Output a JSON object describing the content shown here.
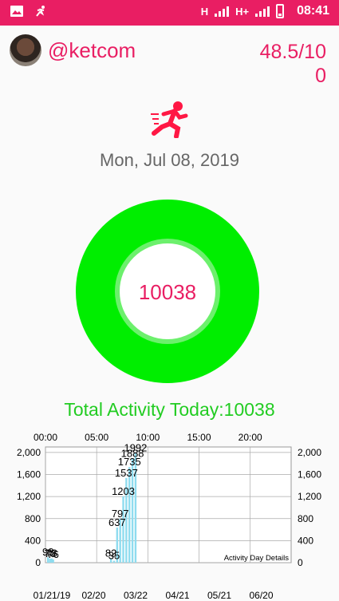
{
  "status_bar": {
    "network_1": "H",
    "network_2": "H+",
    "time": "08:41",
    "left_icons": [
      "image-icon",
      "run-notification-icon"
    ]
  },
  "header": {
    "username": "@ketcom",
    "score": "48.5/100"
  },
  "date": "Mon, Jul 08, 2019",
  "ring": {
    "value": "10038",
    "fill_color": "#00ee00",
    "fraction": 1.0
  },
  "total_label": "Total Activity Today:10038",
  "colors": {
    "accent": "#e91e63",
    "green": "#00ee00",
    "bar": "#8fdcef"
  },
  "chart_data": {
    "type": "bar",
    "top_axis_labels": [
      "00:00",
      "05:00",
      "10:00",
      "15:00",
      "20:00"
    ],
    "bottom_axis_labels": [
      "01/21/19",
      "02/20",
      "03/22",
      "04/21",
      "05/21",
      "06/20"
    ],
    "y_ticks": [
      "0",
      "400",
      "800",
      "1,200",
      "1,600",
      "2,000"
    ],
    "ylim": [
      0,
      2100
    ],
    "xlim_hours": [
      0,
      24
    ],
    "grid": true,
    "description_label": "Activity Day Details",
    "points": [
      {
        "hour": 0.25,
        "value": 98,
        "label": "98"
      },
      {
        "hour": 0.45,
        "value": 70,
        "label": "70"
      },
      {
        "hour": 0.6,
        "value": 78,
        "label": "78"
      },
      {
        "hour": 0.75,
        "value": 60,
        "label": "76"
      },
      {
        "hour": 6.4,
        "value": 82,
        "label": "82"
      },
      {
        "hour": 6.7,
        "value": 35,
        "label": "35"
      },
      {
        "hour": 7.0,
        "value": 637,
        "label": "637"
      },
      {
        "hour": 7.3,
        "value": 797,
        "label": "797"
      },
      {
        "hour": 7.6,
        "value": 1203,
        "label": "1203"
      },
      {
        "hour": 7.9,
        "value": 1537,
        "label": "1537"
      },
      {
        "hour": 8.2,
        "value": 1735,
        "label": "1735"
      },
      {
        "hour": 8.5,
        "value": 1888,
        "label": "1888"
      },
      {
        "hour": 8.8,
        "value": 1992,
        "label": "1992"
      }
    ]
  }
}
